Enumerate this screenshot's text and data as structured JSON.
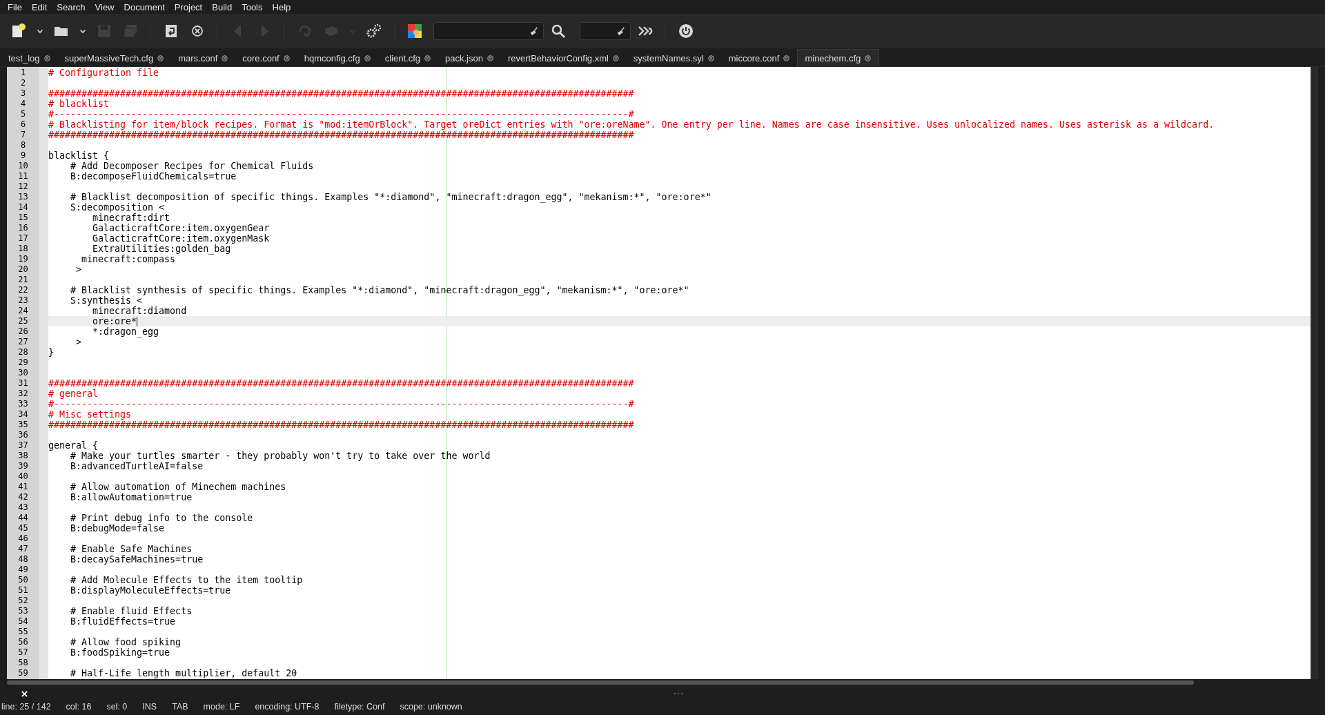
{
  "menu": [
    "File",
    "Edit",
    "Search",
    "View",
    "Document",
    "Project",
    "Build",
    "Tools",
    "Help"
  ],
  "toolbar": [
    [
      {
        "kind": "new",
        "disabled": false
      },
      {
        "kind": "dropdown",
        "disabled": false
      },
      {
        "kind": "open",
        "disabled": false
      },
      {
        "kind": "dropdown",
        "disabled": false
      },
      {
        "kind": "save",
        "disabled": true
      },
      {
        "kind": "saveall",
        "disabled": true
      }
    ],
    [
      {
        "kind": "revert",
        "disabled": false
      },
      {
        "kind": "close",
        "disabled": false
      }
    ],
    [
      {
        "kind": "back",
        "disabled": true
      },
      {
        "kind": "forward",
        "disabled": true
      }
    ],
    [
      {
        "kind": "compile",
        "disabled": true
      },
      {
        "kind": "build",
        "disabled": true
      },
      {
        "kind": "dropdown",
        "disabled": true
      },
      {
        "kind": "prefs",
        "disabled": false
      }
    ],
    [
      {
        "kind": "color",
        "disabled": false
      },
      {
        "kind": "searchfield",
        "disabled": false
      },
      {
        "kind": "search",
        "disabled": false
      },
      {
        "kind": "gotofield",
        "disabled": false
      },
      {
        "kind": "jump",
        "disabled": false
      }
    ],
    [
      {
        "kind": "quit",
        "disabled": false
      }
    ]
  ],
  "tabs": [
    {
      "label": "test_log",
      "selected": false
    },
    {
      "label": "superMassiveTech.cfg",
      "selected": false
    },
    {
      "label": "mars.conf",
      "selected": false
    },
    {
      "label": "core.conf",
      "selected": false
    },
    {
      "label": "hqmconfig.cfg",
      "selected": false
    },
    {
      "label": "client.cfg",
      "selected": false
    },
    {
      "label": "pack.json",
      "selected": false
    },
    {
      "label": "revertBehaviorConfig.xml",
      "selected": false
    },
    {
      "label": "systemNames.syl",
      "selected": false
    },
    {
      "label": "miccore.conf",
      "selected": false
    },
    {
      "label": "minechem.cfg",
      "selected": true
    }
  ],
  "lines": [
    {
      "n": "1",
      "text": "# Configuration file",
      "kind": "comment",
      "current": false
    },
    {
      "n": "2",
      "current": false
    },
    {
      "n": "3",
      "text": "##########################################################################################################",
      "kind": "comment",
      "current": false
    },
    {
      "n": "4",
      "text": "# blacklist",
      "kind": "comment",
      "current": false
    },
    {
      "n": "5",
      "text": "#--------------------------------------------------------------------------------------------------------#",
      "kind": "comment",
      "current": false
    },
    {
      "n": "6",
      "text": "# Blacklisting for item/block recipes. Format is \"mod:itemOrBlock\". Target oreDict entries with \"ore:oreName\". One entry per line. Names are case insensitive. Uses unlocalized names. Uses asterisk as a wildcard.",
      "kind": "comment",
      "current": false
    },
    {
      "n": "7",
      "text": "##########################################################################################################",
      "kind": "comment",
      "current": false
    },
    {
      "n": "8",
      "current": false
    },
    {
      "n": "9",
      "text": "blacklist {",
      "kind": "code",
      "current": false
    },
    {
      "n": "10",
      "text": "    # Add Decomposer Recipes for Chemical Fluids",
      "kind": "code",
      "current": false
    },
    {
      "n": "11",
      "text": "    B:decomposeFluidChemicals=true",
      "kind": "code",
      "current": false
    },
    {
      "n": "12",
      "current": false
    },
    {
      "n": "13",
      "text": "    # Blacklist decomposition of specific things. Examples \"*:diamond\", \"minecraft:dragon_egg\", \"mekanism:*\", \"ore:ore*\"",
      "kind": "code",
      "current": false
    },
    {
      "n": "14",
      "text": "    S:decomposition <",
      "kind": "code",
      "current": false
    },
    {
      "n": "15",
      "text": "        minecraft:dirt",
      "kind": "code",
      "current": false
    },
    {
      "n": "16",
      "text": "        GalacticraftCore:item.oxygenGear",
      "kind": "code",
      "current": false
    },
    {
      "n": "17",
      "text": "        GalacticraftCore:item.oxygenMask",
      "kind": "code",
      "current": false
    },
    {
      "n": "18",
      "text": "        ExtraUtilities:golden_bag",
      "kind": "code",
      "current": false
    },
    {
      "n": "19",
      "text": "      minecraft:compass",
      "kind": "code",
      "current": false
    },
    {
      "n": "20",
      "text": "     >",
      "kind": "code",
      "current": false
    },
    {
      "n": "21",
      "current": false
    },
    {
      "n": "22",
      "text": "    # Blacklist synthesis of specific things. Examples \"*:diamond\", \"minecraft:dragon_egg\", \"mekanism:*\", \"ore:ore*\"",
      "kind": "code",
      "current": false
    },
    {
      "n": "23",
      "text": "    S:synthesis <",
      "kind": "code",
      "current": false
    },
    {
      "n": "24",
      "text": "        minecraft:diamond",
      "kind": "code",
      "current": false
    },
    {
      "n": "25",
      "text": "        ore:ore*",
      "kind": "code",
      "current": true
    },
    {
      "n": "26",
      "text": "        *:dragon_egg",
      "kind": "code",
      "current": false
    },
    {
      "n": "27",
      "text": "     >",
      "kind": "code",
      "current": false
    },
    {
      "n": "28",
      "text": "}",
      "kind": "code",
      "current": false
    },
    {
      "n": "29",
      "current": false
    },
    {
      "n": "30",
      "current": false
    },
    {
      "n": "31",
      "text": "##########################################################################################################",
      "kind": "comment",
      "current": false
    },
    {
      "n": "32",
      "text": "# general",
      "kind": "comment",
      "current": false
    },
    {
      "n": "33",
      "text": "#--------------------------------------------------------------------------------------------------------#",
      "kind": "comment",
      "current": false
    },
    {
      "n": "34",
      "text": "# Misc settings",
      "kind": "comment",
      "current": false
    },
    {
      "n": "35",
      "text": "##########################################################################################################",
      "kind": "comment",
      "current": false
    },
    {
      "n": "36",
      "current": false
    },
    {
      "n": "37",
      "text": "general {",
      "kind": "code",
      "current": false
    },
    {
      "n": "38",
      "text": "    # Make your turtles smarter - they probably won't try to take over the world",
      "kind": "code",
      "current": false
    },
    {
      "n": "39",
      "text": "    B:advancedTurtleAI=false",
      "kind": "code",
      "current": false
    },
    {
      "n": "40",
      "current": false
    },
    {
      "n": "41",
      "text": "    # Allow automation of Minechem machines",
      "kind": "code",
      "current": false
    },
    {
      "n": "42",
      "text": "    B:allowAutomation=true",
      "kind": "code",
      "current": false
    },
    {
      "n": "43",
      "current": false
    },
    {
      "n": "44",
      "text": "    # Print debug info to the console",
      "kind": "code",
      "current": false
    },
    {
      "n": "45",
      "text": "    B:debugMode=false",
      "kind": "code",
      "current": false
    },
    {
      "n": "46",
      "current": false
    },
    {
      "n": "47",
      "text": "    # Enable Safe Machines",
      "kind": "code",
      "current": false
    },
    {
      "n": "48",
      "text": "    B:decaySafeMachines=true",
      "kind": "code",
      "current": false
    },
    {
      "n": "49",
      "current": false
    },
    {
      "n": "50",
      "text": "    # Add Molecule Effects to the item tooltip",
      "kind": "code",
      "current": false
    },
    {
      "n": "51",
      "text": "    B:displayMoleculeEffects=true",
      "kind": "code",
      "current": false
    },
    {
      "n": "52",
      "current": false
    },
    {
      "n": "53",
      "text": "    # Enable fluid Effects",
      "kind": "code",
      "current": false
    },
    {
      "n": "54",
      "text": "    B:fluidEffects=true",
      "kind": "code",
      "current": false
    },
    {
      "n": "55",
      "current": false
    },
    {
      "n": "56",
      "text": "    # Allow food spiking",
      "kind": "code",
      "current": false
    },
    {
      "n": "57",
      "text": "    B:foodSpiking=true",
      "kind": "code",
      "current": false
    },
    {
      "n": "58",
      "current": false
    },
    {
      "n": "59",
      "text": "    # Half-Life length multiplier, default 20",
      "kind": "code",
      "current": false
    }
  ],
  "status_bar": [
    "line: 25 / 142",
    "col: 16",
    "sel: 0",
    "INS",
    "TAB",
    "mode: LF",
    "encoding: UTF-8",
    "filetype: Conf",
    "scope: unknown"
  ]
}
